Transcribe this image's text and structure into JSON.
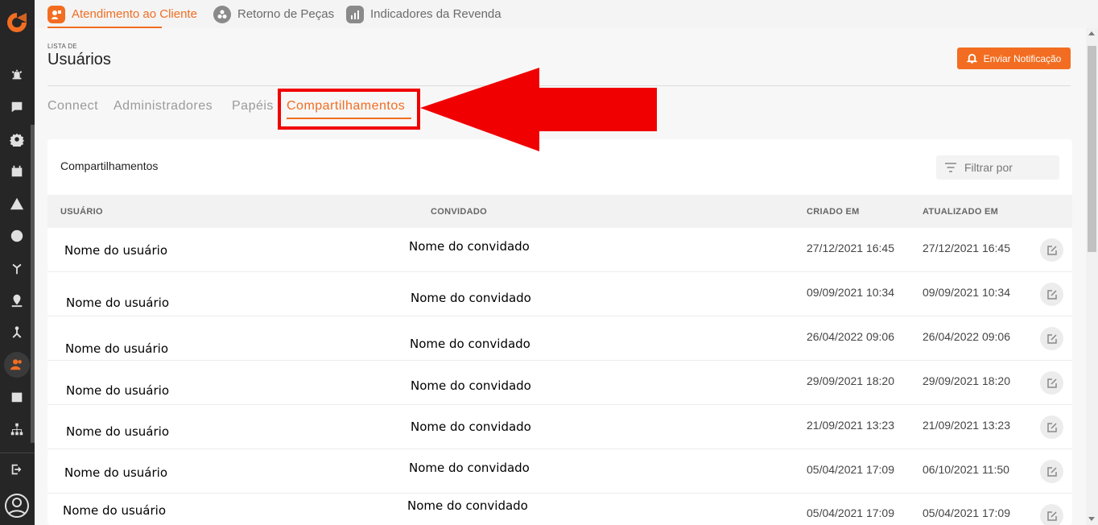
{
  "top_tabs": [
    {
      "label": "Atendimento ao Cliente",
      "icon": "customer-service-icon",
      "active": true
    },
    {
      "label": "Retorno de Peças",
      "icon": "parts-return-icon",
      "active": false
    },
    {
      "label": "Indicadores da Revenda",
      "icon": "bar-chart-icon",
      "active": false
    }
  ],
  "header": {
    "overline": "LISTA DE",
    "title": "Usuários",
    "notify_button": "Enviar Notificação"
  },
  "sub_tabs": [
    {
      "label": "Connect"
    },
    {
      "label": "Administradores"
    },
    {
      "label": "Papéis"
    },
    {
      "label": "Compartilhamentos",
      "active": true
    }
  ],
  "card": {
    "title": "Compartilhamentos",
    "filter_label": "Filtrar por"
  },
  "table": {
    "headers": [
      "USUÁRIO",
      "CONVIDADO",
      "CRIADO EM",
      "ATUALIZADO EM"
    ],
    "rows": [
      {
        "user": "Nome do usuário",
        "guest": "Nome do convidado",
        "created": "27/12/2021 16:45",
        "updated": "27/12/2021 16:45"
      },
      {
        "user": "Nome do usuário",
        "guest": "Nome do convidado",
        "created": "09/09/2021 10:34",
        "updated": "09/09/2021 10:34"
      },
      {
        "user": "Nome do usuário",
        "guest": "Nome do convidado",
        "created": "26/04/2022 09:06",
        "updated": "26/04/2022 09:06"
      },
      {
        "user": "Nome do usuário",
        "guest": "Nome do convidado",
        "created": "29/09/2021 18:20",
        "updated": "29/09/2021 18:20"
      },
      {
        "user": "Nome do usuário",
        "guest": "Nome do convidado",
        "created": "21/09/2021 13:23",
        "updated": "21/09/2021 13:23"
      },
      {
        "user": "Nome do usuário",
        "guest": "Nome do convidado",
        "created": "05/04/2021 17:09",
        "updated": "06/10/2021 11:50"
      },
      {
        "user": "Nome do usuário",
        "guest": "Nome do convidado",
        "created": "05/04/2021 17:09",
        "updated": "05/04/2021 17:09"
      }
    ]
  },
  "sidebar_icons": [
    "alarm-icon",
    "chat-icon",
    "settings-icon",
    "calendar-check-icon",
    "warning-icon",
    "globe-icon",
    "plant-icon",
    "location-user-icon",
    "network-icon",
    "users-icon",
    "calendar-icon",
    "hierarchy-icon",
    "logout-icon",
    "account-icon"
  ],
  "colors": {
    "accent": "#f26d21",
    "sidebar": "#262626",
    "annotation": "#f00000"
  }
}
